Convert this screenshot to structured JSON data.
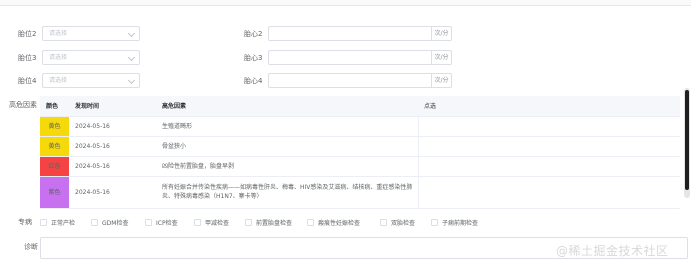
{
  "form": {
    "rows": [
      {
        "left_label": "胎位2",
        "select_placeholder": "请选择",
        "right_label": "胎心2",
        "unit": "次/分"
      },
      {
        "left_label": "胎位3",
        "select_placeholder": "请选择",
        "right_label": "胎心3",
        "unit": "次/分"
      },
      {
        "left_label": "胎位4",
        "select_placeholder": "请选择",
        "right_label": "胎心4",
        "unit": "次/分"
      }
    ]
  },
  "risk": {
    "label": "高危因素",
    "headers": {
      "color": "颜色",
      "date": "发现时间",
      "factor": "高危因素",
      "action": "点选"
    },
    "rows": [
      {
        "color_name": "黄色",
        "color_hex": "#f5d90a",
        "date": "2024-05-16",
        "factor": "生殖道畸形"
      },
      {
        "color_name": "黄色",
        "color_hex": "#f5d90a",
        "date": "2024-05-16",
        "factor": "骨盆狭小"
      },
      {
        "color_name": "红色",
        "color_hex": "#f54343",
        "date": "2024-05-16",
        "factor": "凶险性前置胎盘，胎盘早剥"
      },
      {
        "color_name": "紫色",
        "color_hex": "#c770f0",
        "date": "2024-05-16",
        "factor": "所有妊娠合并传染性疾病——如病毒性肝炎、梅毒、HIV感染及艾滋病、结核病、重症感染性肺炎、特殊病毒感染（H1N7、寨卡等）"
      }
    ]
  },
  "special": {
    "label": "专病",
    "options": [
      "正常产检",
      "GDM检查",
      "ICP检查",
      "甲减检查",
      "前置胎盘检查",
      "瘢痕性妊娠检查",
      "双胎检查",
      "子痫前期检查"
    ]
  },
  "diagnosis": {
    "label": "诊断",
    "value": ""
  },
  "watermark": "@稀土掘金技术社区"
}
